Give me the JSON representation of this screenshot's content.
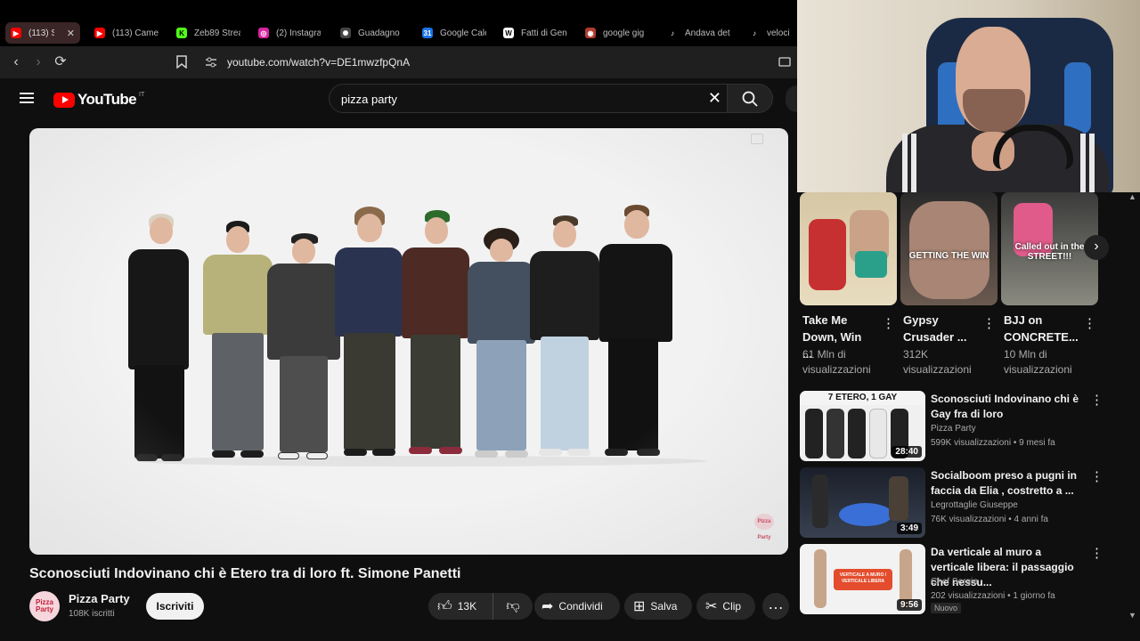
{
  "tabs": [
    {
      "label": "(113) S",
      "color": "#ff0000",
      "icon": "youtube-icon",
      "active": true
    },
    {
      "label": "(113) Came",
      "color": "#ff0000",
      "icon": "youtube-icon"
    },
    {
      "label": "Zeb89 Strea",
      "color": "#53fc18",
      "icon": "kick-icon"
    },
    {
      "label": "(2) Instagra",
      "color": "#d6249f",
      "icon": "instagram-icon"
    },
    {
      "label": "Guadagno",
      "color": "#444444",
      "icon": "chatgpt-icon"
    },
    {
      "label": "Google Cale",
      "color": "#1a73e8",
      "icon": "calendar-icon"
    },
    {
      "label": "Fatti di Gen",
      "color": "#ffffff",
      "icon": "wikipedia-icon"
    },
    {
      "label": "google gig",
      "color": "#b03a2e",
      "icon": "gemini-icon"
    },
    {
      "label": "Andava det",
      "color": "#000000",
      "icon": "tiktok-icon"
    },
    {
      "label": "veloci",
      "color": "#000000",
      "icon": "tiktok-icon"
    }
  ],
  "browser": {
    "url": "youtube.com/watch?v=DE1mwzfpQnA",
    "back_icon": "‹",
    "forward_icon": "›",
    "reload_icon": "⟳"
  },
  "youtube": {
    "logo_text": "YouTube",
    "region": "IT",
    "search_query": "pizza party",
    "clear_icon": "✕"
  },
  "video": {
    "title": "Sconosciuti Indovinano chi è Etero tra di loro ft. Simone Panetti",
    "channel": "Pizza Party",
    "subscribers": "108K iscritti",
    "subscribe_label": "Iscriviti",
    "likes": "13K",
    "share_label": "Condividi",
    "save_label": "Salva",
    "clip_label": "Clip",
    "avatar_text": "Pizza Party",
    "watermark_text": "Pizza Party"
  },
  "shorts": [
    {
      "title": "Take Me Down, Win ...",
      "views": "61 Mln di visualizzazioni",
      "overlay": ""
    },
    {
      "title": "Gypsy Crusader ...",
      "views": "312K visualizzazioni",
      "overlay": "GETTING THE WIN"
    },
    {
      "title": "BJJ on CONCRETE...",
      "views": "10 Mln di visualizzazioni",
      "overlay": "Called out in the STREET!!!"
    }
  ],
  "recommended": [
    {
      "title": "Sconosciuti Indovinano chi è Gay fra di loro",
      "channel": "Pizza Party",
      "meta": "599K visualizzazioni • 9 mesi fa",
      "duration": "28:40",
      "overlay": "7 ETERO, 1 GAY",
      "badge": ""
    },
    {
      "title": "Socialboom preso a pugni in faccia da Elia , costretto a ...",
      "channel": "Legrottaglie Giuseppe",
      "meta": "76K visualizzazioni • 4 anni fa",
      "duration": "3:49",
      "overlay": "",
      "badge": ""
    },
    {
      "title": "Da verticale al muro a verticale libera: il passaggio che nessu...",
      "channel": "Chef Sergio",
      "meta": "202 visualizzazioni • 1 giorno fa",
      "duration": "9:56",
      "overlay": "VERTICALE A MURO / VERTICALE LIBERA",
      "badge": "Nuovo"
    }
  ]
}
